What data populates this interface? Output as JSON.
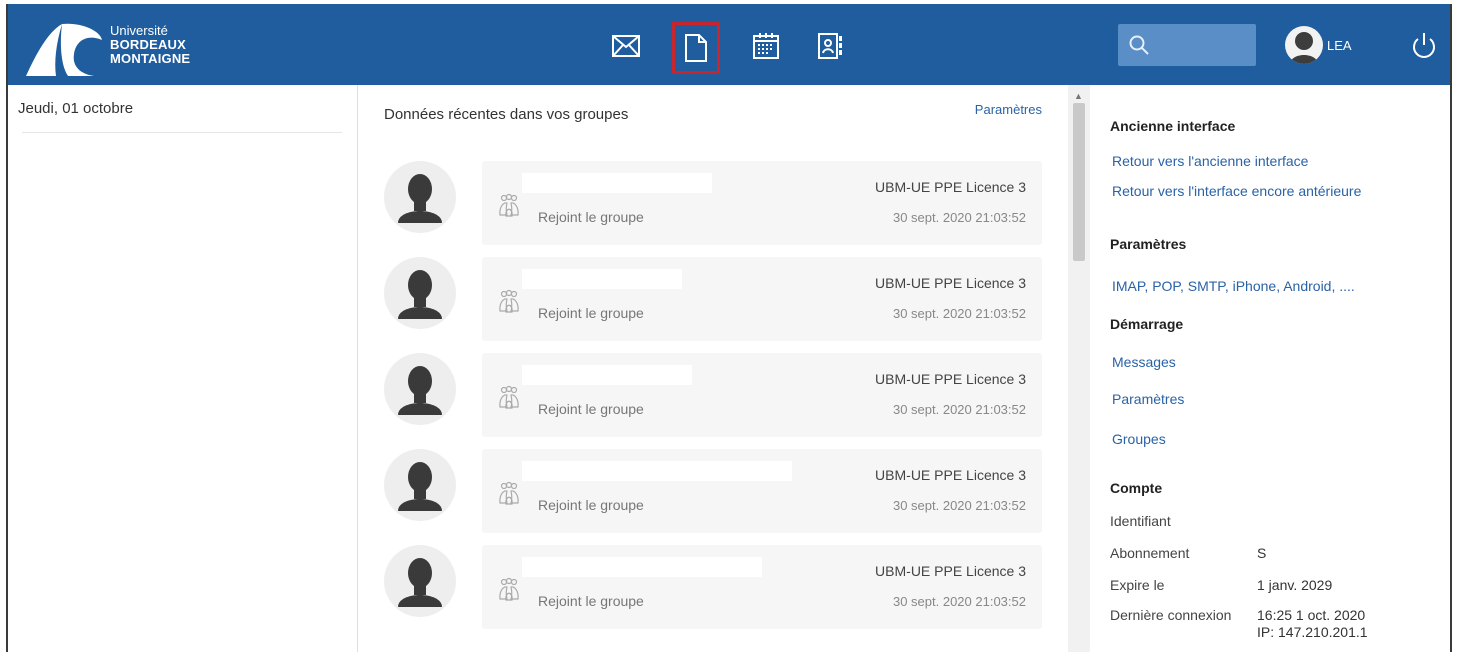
{
  "header": {
    "logo": {
      "line1": "Université",
      "line2": "BORDEAUX",
      "line3": "MONTAIGNE"
    },
    "nav": [
      {
        "name": "mail-icon"
      },
      {
        "name": "document-icon",
        "active": true
      },
      {
        "name": "calendar-icon"
      },
      {
        "name": "contacts-icon"
      }
    ],
    "search": {
      "placeholder": ""
    },
    "user": {
      "name": "LEA"
    },
    "colors": {
      "bar": "#1f5d9e",
      "search_bg": "#5a8ec6",
      "active_outline": "#c8262c",
      "link": "#2a62a6"
    }
  },
  "left": {
    "date": "Jeudi, 01 octobre"
  },
  "middle": {
    "title": "Données récentes dans vos groupes",
    "params_link": "Paramètres",
    "items": [
      {
        "action": "Rejoint le groupe",
        "group": "UBM-UE PPE Licence 3",
        "time": "30 sept. 2020 21:03:52"
      },
      {
        "action": "Rejoint le groupe",
        "group": "UBM-UE PPE Licence 3",
        "time": "30 sept. 2020 21:03:52"
      },
      {
        "action": "Rejoint le groupe",
        "group": "UBM-UE PPE Licence 3",
        "time": "30 sept. 2020 21:03:52"
      },
      {
        "action": "Rejoint le groupe",
        "group": "UBM-UE PPE Licence 3",
        "time": "30 sept. 2020 21:03:52"
      },
      {
        "action": "Rejoint le groupe",
        "group": "UBM-UE PPE Licence 3",
        "time": "30 sept. 2020 21:03:52"
      }
    ]
  },
  "right": {
    "old_interface": {
      "title": "Ancienne interface",
      "links": [
        "Retour vers l'ancienne interface",
        "Retour vers l'interface encore antérieure"
      ]
    },
    "settings": {
      "title": "Paramètres",
      "links": [
        "IMAP, POP, SMTP, iPhone, Android, ...."
      ]
    },
    "startup": {
      "title": "Démarrage",
      "links": [
        "Messages",
        "Paramètres",
        "Groupes"
      ]
    },
    "account": {
      "title": "Compte",
      "identifier_label": "Identifiant",
      "subscription_label": "Abonnement",
      "subscription_value": "S",
      "expires_label": "Expire le",
      "expires_value": "1 janv. 2029",
      "last_login_label": "Dernière connexion",
      "last_login_value": "16:25 1 oct. 2020",
      "ip_value": "IP: 147.210.201.1"
    }
  }
}
